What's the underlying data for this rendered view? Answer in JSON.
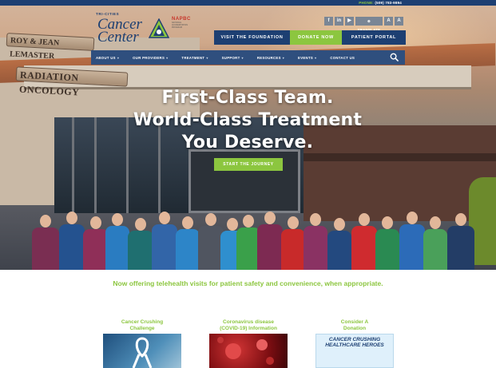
{
  "topbar": {
    "phone_label": "PHONE:",
    "phone_number": "(509) 783-9894"
  },
  "brand": {
    "tagline": "TRI-CITIES",
    "name_line1": "Cancer",
    "name_line2": "Center",
    "partner_logo_text": "NAPBC",
    "partner_logo_sub": "NATIONAL ACCREDITATION PROGRAM"
  },
  "social": {
    "items": [
      {
        "icon": "facebook-icon",
        "glyph": "f"
      },
      {
        "icon": "linkedin-icon",
        "glyph": "in"
      },
      {
        "icon": "youtube-icon",
        "glyph": "▶"
      }
    ],
    "translate_label": "TRANSLATE",
    "font_smaller": "A",
    "font_larger": "A"
  },
  "actions": {
    "visit": "VISIT THE FOUNDATION",
    "donate": "DONATE NOW",
    "portal": "PATIENT PORTAL"
  },
  "nav": {
    "items": [
      {
        "label": "ABOUT US",
        "has_menu": true
      },
      {
        "label": "OUR PROVIDERS",
        "has_menu": true
      },
      {
        "label": "TREATMENT",
        "has_menu": true
      },
      {
        "label": "SUPPORT",
        "has_menu": true
      },
      {
        "label": "RESOURCES",
        "has_menu": true
      },
      {
        "label": "EVENTS",
        "has_menu": true
      },
      {
        "label": "CONTACT US",
        "has_menu": false
      }
    ]
  },
  "hero": {
    "sign_left": "ROY & JEAN LEMASTER",
    "sign_building": "RADIATION ONCOLOGY",
    "line1": "First-Class Team.",
    "line2": "World-Class Treatment",
    "line3": "You Deserve.",
    "cta": "START THE JOURNEY"
  },
  "telehealth": "Now offering telehealth visits for patient safety and convenience, when appropriate.",
  "cards": [
    {
      "title_line1": "Cancer Crushing",
      "title_line2": "Challenge"
    },
    {
      "title_line1": "Coronavirus disease",
      "title_line2": "(COVID-19) Information"
    },
    {
      "title_line1": "Consider A",
      "title_line2": "Donation",
      "image_text": "CANCER CRUSHING HEALTHCARE HEROES"
    }
  ],
  "colors": {
    "navy": "#1d3f72",
    "green": "#8cc63f",
    "nav": "#2f4f7e"
  }
}
